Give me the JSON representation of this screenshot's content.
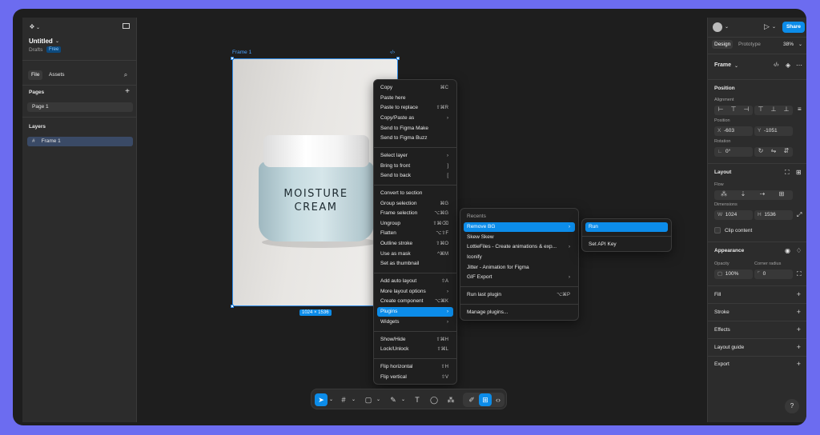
{
  "file": {
    "title": "Untitled",
    "location": "Drafts",
    "badge": "Free"
  },
  "left_tabs": {
    "file": "File",
    "assets": "Assets"
  },
  "pages": {
    "heading": "Pages",
    "items": [
      "Page 1"
    ]
  },
  "layers": {
    "heading": "Layers",
    "items": [
      "Frame 1"
    ]
  },
  "canvas": {
    "frame_label": "Frame 1",
    "dimensions_badge": "1024 × 1536",
    "product_text_line1": "MOISTURE",
    "product_text_line2": "CREAM"
  },
  "context_menu": {
    "items": [
      {
        "label": "Copy",
        "shortcut": "⌘C"
      },
      {
        "label": "Paste here",
        "shortcut": ""
      },
      {
        "label": "Paste to replace",
        "shortcut": "⇧⌘R"
      },
      {
        "label": "Copy/Paste as",
        "shortcut": "›"
      },
      {
        "label": "Send to Figma Make",
        "shortcut": ""
      },
      {
        "label": "Send to Figma Buzz",
        "shortcut": ""
      },
      {
        "label": "Select layer",
        "shortcut": "›"
      },
      {
        "label": "Bring to front",
        "shortcut": "]"
      },
      {
        "label": "Send to back",
        "shortcut": "["
      },
      {
        "label": "Convert to section",
        "shortcut": ""
      },
      {
        "label": "Group selection",
        "shortcut": "⌘G"
      },
      {
        "label": "Frame selection",
        "shortcut": "⌥⌘G"
      },
      {
        "label": "Ungroup",
        "shortcut": "⇧⌘⌫"
      },
      {
        "label": "Flatten",
        "shortcut": "⌥⇧F"
      },
      {
        "label": "Outline stroke",
        "shortcut": "⇧⌘O"
      },
      {
        "label": "Use as mask",
        "shortcut": "^⌘M"
      },
      {
        "label": "Set as thumbnail",
        "shortcut": ""
      },
      {
        "label": "Add auto layout",
        "shortcut": "⇧A"
      },
      {
        "label": "More layout options",
        "shortcut": "›"
      },
      {
        "label": "Create component",
        "shortcut": "⌥⌘K"
      },
      {
        "label": "Plugins",
        "shortcut": "›"
      },
      {
        "label": "Widgets",
        "shortcut": "›"
      },
      {
        "label": "Show/Hide",
        "shortcut": "⇧⌘H"
      },
      {
        "label": "Lock/Unlock",
        "shortcut": "⇧⌘L"
      },
      {
        "label": "Flip horizontal",
        "shortcut": "⇧H"
      },
      {
        "label": "Flip vertical",
        "shortcut": "⇧V"
      }
    ]
  },
  "plugins_menu": {
    "heading": "Recents",
    "items": [
      {
        "label": "Remove BG",
        "shortcut": "›"
      },
      {
        "label": "Skew Skew",
        "shortcut": ""
      },
      {
        "label": "LottieFiles - Create animations & exp...",
        "shortcut": "›"
      },
      {
        "label": "Iconify",
        "shortcut": ""
      },
      {
        "label": "Jitter - Animation for Figma",
        "shortcut": ""
      },
      {
        "label": "GIF Export",
        "shortcut": "›"
      },
      {
        "label": "Run last plugin",
        "shortcut": "⌥⌘P"
      },
      {
        "label": "Manage plugins...",
        "shortcut": ""
      }
    ]
  },
  "removebg_menu": {
    "items": [
      "Run",
      "Set API Key"
    ]
  },
  "right_panel": {
    "share": "Share",
    "tabs": {
      "design": "Design",
      "prototype": "Prototype",
      "zoom": "38%"
    },
    "selection": "Frame",
    "position": {
      "heading": "Position",
      "alignment": "Alignment",
      "position_label": "Position",
      "x": "-603",
      "y": "-1051",
      "rotation_label": "Rotation",
      "rotation": "0°"
    },
    "layout": {
      "heading": "Layout",
      "flow": "Flow",
      "dimensions": "Dimensions",
      "w": "1024",
      "h": "1536",
      "clip": "Clip content"
    },
    "appearance": {
      "heading": "Appearance",
      "opacity_label": "Opacity",
      "opacity": "100%",
      "radius_label": "Corner radius",
      "radius": "0"
    },
    "fill": "Fill",
    "stroke": "Stroke",
    "effects": "Effects",
    "layout_guide": "Layout guide",
    "export": "Export"
  },
  "help": "?",
  "colors": {
    "accent": "#0c8ce9",
    "background": "#6c6cf0",
    "panel": "#2c2c2c"
  }
}
